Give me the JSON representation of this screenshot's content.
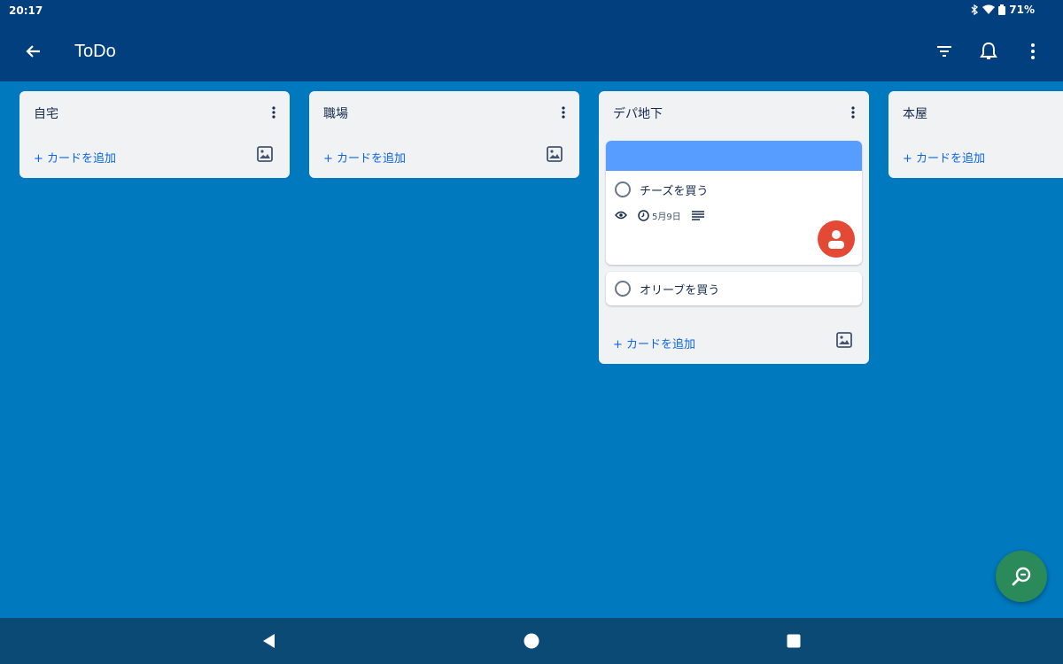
{
  "status_bar": {
    "time": "20:17",
    "battery": "71%"
  },
  "app_bar": {
    "title": "ToDo"
  },
  "lists": [
    {
      "title": "自宅",
      "add_card": "+ カードを追加",
      "cards": []
    },
    {
      "title": "職場",
      "add_card": "+ カードを追加",
      "cards": []
    },
    {
      "title": "デパ地下",
      "add_card": "+ カードを追加",
      "cards": [
        {
          "title": "チーズを買う",
          "cover_color": "#579dff",
          "due": "5月9日",
          "has_avatar": true
        },
        {
          "title": "オリーブを買う"
        }
      ]
    },
    {
      "title": "本屋",
      "add_card": "+ カードを追加",
      "cards": []
    }
  ],
  "icons": {
    "back": "arrow-left-icon",
    "filter": "filter-icon",
    "notifications": "bell-icon",
    "menu": "more-vert-icon",
    "fab": "zoom-out-icon",
    "watch": "eye-icon",
    "due": "clock-icon",
    "description": "description-icon"
  },
  "colors": {
    "board_bg": "#0079bf",
    "app_bar": "#013f7f",
    "nav_bar": "#0b4a75",
    "fab": "#2a8a5a",
    "avatar": "#e34935",
    "link": "#0c66e4"
  }
}
